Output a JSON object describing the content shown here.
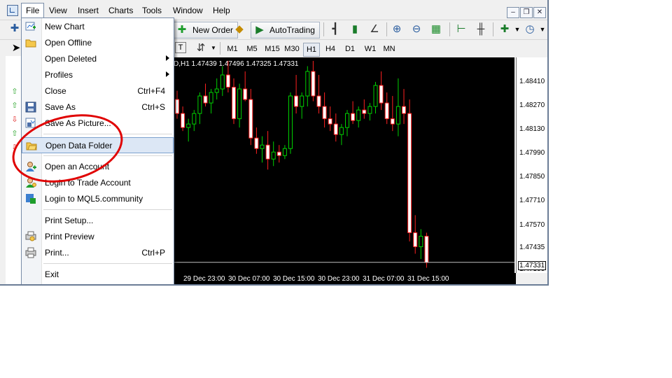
{
  "menubar": {
    "items": [
      "File",
      "View",
      "Insert",
      "Charts",
      "Tools",
      "Window",
      "Help"
    ]
  },
  "toolbar": {
    "new_order": "New Order",
    "autotrading": "AutoTrading",
    "timeframes": [
      "M1",
      "M5",
      "M15",
      "M30",
      "H1",
      "H4",
      "D1",
      "W1",
      "MN"
    ],
    "selected_timeframe": "H1"
  },
  "file_menu": {
    "items": [
      {
        "label": "New Chart",
        "shortcut": "",
        "icon": "new-chart-icon"
      },
      {
        "label": "Open Offline",
        "shortcut": "",
        "icon": "folder-icon"
      },
      {
        "label": "Open Deleted",
        "shortcut": "",
        "icon": "",
        "submenu": true
      },
      {
        "label": "Profiles",
        "shortcut": "",
        "icon": "",
        "submenu": true
      },
      {
        "label": "Close",
        "shortcut": "Ctrl+F4",
        "icon": ""
      },
      {
        "label": "Save As",
        "shortcut": "Ctrl+S",
        "icon": "save-icon"
      },
      {
        "label": "Save As Picture...",
        "shortcut": "",
        "icon": "picture-icon"
      },
      {
        "label": "Open Data Folder",
        "shortcut": "",
        "icon": "folder-icon",
        "highlighted": true
      },
      {
        "label": "Open an Account",
        "shortcut": "",
        "icon": "account-icon"
      },
      {
        "label": "Login to Trade Account",
        "shortcut": "",
        "icon": "login-icon"
      },
      {
        "label": "Login to MQL5.community",
        "shortcut": "",
        "icon": "mql5-icon"
      },
      {
        "label": "Print Setup...",
        "shortcut": "",
        "icon": ""
      },
      {
        "label": "Print Preview",
        "shortcut": "",
        "icon": "print-preview-icon"
      },
      {
        "label": "Print...",
        "shortcut": "Ctrl+P",
        "icon": "printer-icon"
      },
      {
        "label": "Exit",
        "shortcut": "",
        "icon": ""
      }
    ]
  },
  "chart": {
    "header": "D,H1  1.47439 1.47496 1.47325 1.47331",
    "price_labels": [
      "1.48410",
      "1.48270",
      "1.48130",
      "1.47990",
      "1.47850",
      "1.47710",
      "1.47570",
      "1.47435",
      "1.47331",
      "1.47300"
    ],
    "current_price": "1.47331",
    "time_labels": [
      "29 Dec 23:00",
      "30 Dec 07:00",
      "30 Dec 15:00",
      "30 Dec 23:00",
      "31 Dec 07:00",
      "31 Dec 15:00"
    ],
    "bull_color": "#00d000",
    "bear_color": "#ff2020",
    "candles": [
      [
        1.4826,
        1.4831,
        1.4815,
        1.4818
      ],
      [
        1.4818,
        1.4822,
        1.4808,
        1.481
      ],
      [
        1.481,
        1.4815,
        1.4802,
        1.4812
      ],
      [
        1.4812,
        1.482,
        1.4808,
        1.4818
      ],
      [
        1.4818,
        1.483,
        1.4812,
        1.4828
      ],
      [
        1.4828,
        1.4835,
        1.4822,
        1.4824
      ],
      [
        1.4824,
        1.4832,
        1.4818,
        1.483
      ],
      [
        1.483,
        1.4838,
        1.4826,
        1.4832
      ],
      [
        1.4832,
        1.4845,
        1.4828,
        1.484
      ],
      [
        1.484,
        1.4848,
        1.483,
        1.4833
      ],
      [
        1.4833,
        1.4838,
        1.4812,
        1.4815
      ],
      [
        1.4815,
        1.4835,
        1.481,
        1.4832
      ],
      [
        1.4832,
        1.4842,
        1.4825,
        1.4826
      ],
      [
        1.4826,
        1.4832,
        1.48,
        1.4804
      ],
      [
        1.4804,
        1.481,
        1.4795,
        1.4798
      ],
      [
        1.4798,
        1.4805,
        1.479,
        1.48
      ],
      [
        1.48,
        1.4808,
        1.4786,
        1.4792
      ],
      [
        1.4792,
        1.4802,
        1.4788,
        1.4796
      ],
      [
        1.4796,
        1.48,
        1.479,
        1.4794
      ],
      [
        1.4794,
        1.48,
        1.4792,
        1.4798
      ],
      [
        1.4798,
        1.483,
        1.4795,
        1.4828
      ],
      [
        1.4828,
        1.484,
        1.4818,
        1.4822
      ],
      [
        1.4822,
        1.483,
        1.4815,
        1.4828
      ],
      [
        1.4828,
        1.4845,
        1.4822,
        1.4842
      ],
      [
        1.4842,
        1.4848,
        1.4825,
        1.4828
      ],
      [
        1.4828,
        1.484,
        1.4818,
        1.4822
      ],
      [
        1.4822,
        1.483,
        1.481,
        1.4815
      ],
      [
        1.4815,
        1.4822,
        1.4808,
        1.4812
      ],
      [
        1.4812,
        1.4818,
        1.4802,
        1.4806
      ],
      [
        1.4806,
        1.4812,
        1.48,
        1.481
      ],
      [
        1.481,
        1.482,
        1.4805,
        1.4818
      ],
      [
        1.4818,
        1.4825,
        1.4812,
        1.4814
      ],
      [
        1.4814,
        1.4822,
        1.481,
        1.482
      ],
      [
        1.482,
        1.4826,
        1.4815,
        1.4818
      ],
      [
        1.4818,
        1.4824,
        1.4814,
        1.4822
      ],
      [
        1.4822,
        1.4836,
        1.4818,
        1.4834
      ],
      [
        1.4834,
        1.4842,
        1.482,
        1.4824
      ],
      [
        1.4824,
        1.483,
        1.4812,
        1.4815
      ],
      [
        1.4815,
        1.4828,
        1.4808,
        1.4812
      ],
      [
        1.4812,
        1.4838,
        1.4805,
        1.4822
      ],
      [
        1.4822,
        1.4832,
        1.4812,
        1.4818
      ],
      [
        1.4818,
        1.4826,
        1.4745,
        1.475
      ],
      [
        1.475,
        1.476,
        1.4738,
        1.4742
      ],
      [
        1.4742,
        1.4752,
        1.4735,
        1.4748
      ],
      [
        1.4748,
        1.475,
        1.473,
        1.4733
      ]
    ]
  },
  "chart_data": {
    "type": "candlestick",
    "title": "",
    "xlabel": "",
    "ylabel": "",
    "ylim": [
      1.4727,
      1.485
    ],
    "x_tick_labels": [
      "29 Dec 23:00",
      "30 Dec 07:00",
      "30 Dec 15:00",
      "30 Dec 23:00",
      "31 Dec 07:00",
      "31 Dec 15:00"
    ]
  }
}
